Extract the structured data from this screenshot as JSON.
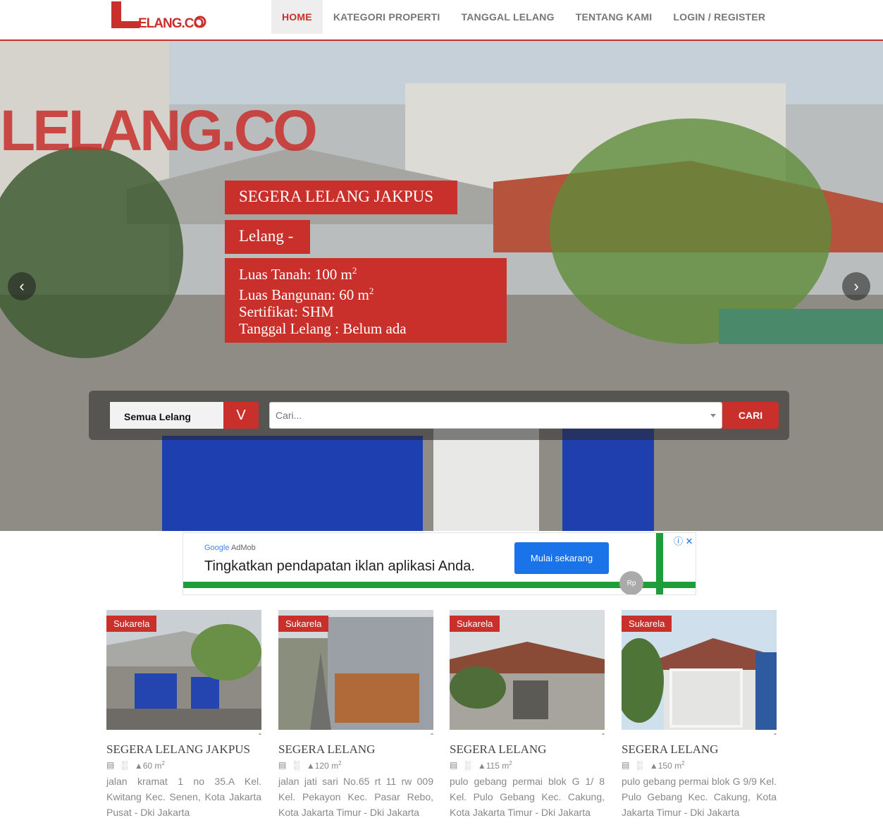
{
  "brand": {
    "logo_text": "LELANG.CO"
  },
  "nav": {
    "items": [
      {
        "label": "HOME",
        "active": true
      },
      {
        "label": "KATEGORI PROPERTI",
        "active": false
      },
      {
        "label": "TANGGAL LELANG",
        "active": false
      },
      {
        "label": "TENTANG KAMI",
        "active": false
      },
      {
        "label": "LOGIN / REGISTER",
        "active": false
      }
    ]
  },
  "hero": {
    "watermark_text": "LELANG.CO",
    "title": "SEGERA LELANG JAKPUS",
    "price": "Lelang -",
    "details": {
      "luas_tanah": "Luas Tanah: 100 m",
      "luas_bangunan": "Luas Bangunan: 60 m",
      "sertifikat": "Sertifikat: SHM",
      "tanggal": "Tanggal Lelang : Belum ada",
      "sup": "2"
    },
    "prev_icon": "chevron-left-icon",
    "next_icon": "chevron-right-icon"
  },
  "search": {
    "category_value": "Semua Lelang",
    "category_toggle": "V",
    "placeholder": "Cari...",
    "button_label": "CARI"
  },
  "ad": {
    "brand_google": "Google",
    "brand_admob": "AdMob",
    "headline": "Tingkatkan pendapatan iklan aplikasi Anda.",
    "cta": "Mulai sekarang",
    "coin_label": "Rp",
    "info_icons": "ⓘ ✕"
  },
  "listings": [
    {
      "badge": "Sukarela",
      "dash": "-",
      "title": "SEGERA LELANG JAKPUS",
      "area": "60 m",
      "area_sup": "2",
      "address": "jalan kramat 1 no 35.A Kel. Kwitang Kec. Senen, Kota Jakarta Pusat - Dki Jakarta"
    },
    {
      "badge": "Sukarela",
      "dash": "-",
      "title": "SEGERA LELANG",
      "area": "120 m",
      "area_sup": "2",
      "address": "jalan jati sari No.65 rt 11 rw 009 Kel. Pekayon Kec. Pasar Rebo, Kota Jakarta Timur - Dki Jakarta"
    },
    {
      "badge": "Sukarela",
      "dash": "-",
      "title": "SEGERA LELANG",
      "area": "115 m",
      "area_sup": "2",
      "address": "pulo gebang permai blok G 1/ 8 Kel. Pulo Gebang Kec. Cakung, Kota Jakarta Timur - Dki Jakarta"
    },
    {
      "badge": "Sukarela",
      "dash": "-",
      "title": "SEGERA LELANG",
      "area": "150 m",
      "area_sup": "2",
      "address": "pulo gebang permai blok G 9/9 Kel. Pulo Gebang Kec. Cakung, Kota Jakarta Timur - Dki Jakarta"
    }
  ],
  "colors": {
    "accent": "#c9302c",
    "nav_text": "#777777",
    "ad_green": "#1e9e3a",
    "ad_blue": "#1a73e8"
  }
}
